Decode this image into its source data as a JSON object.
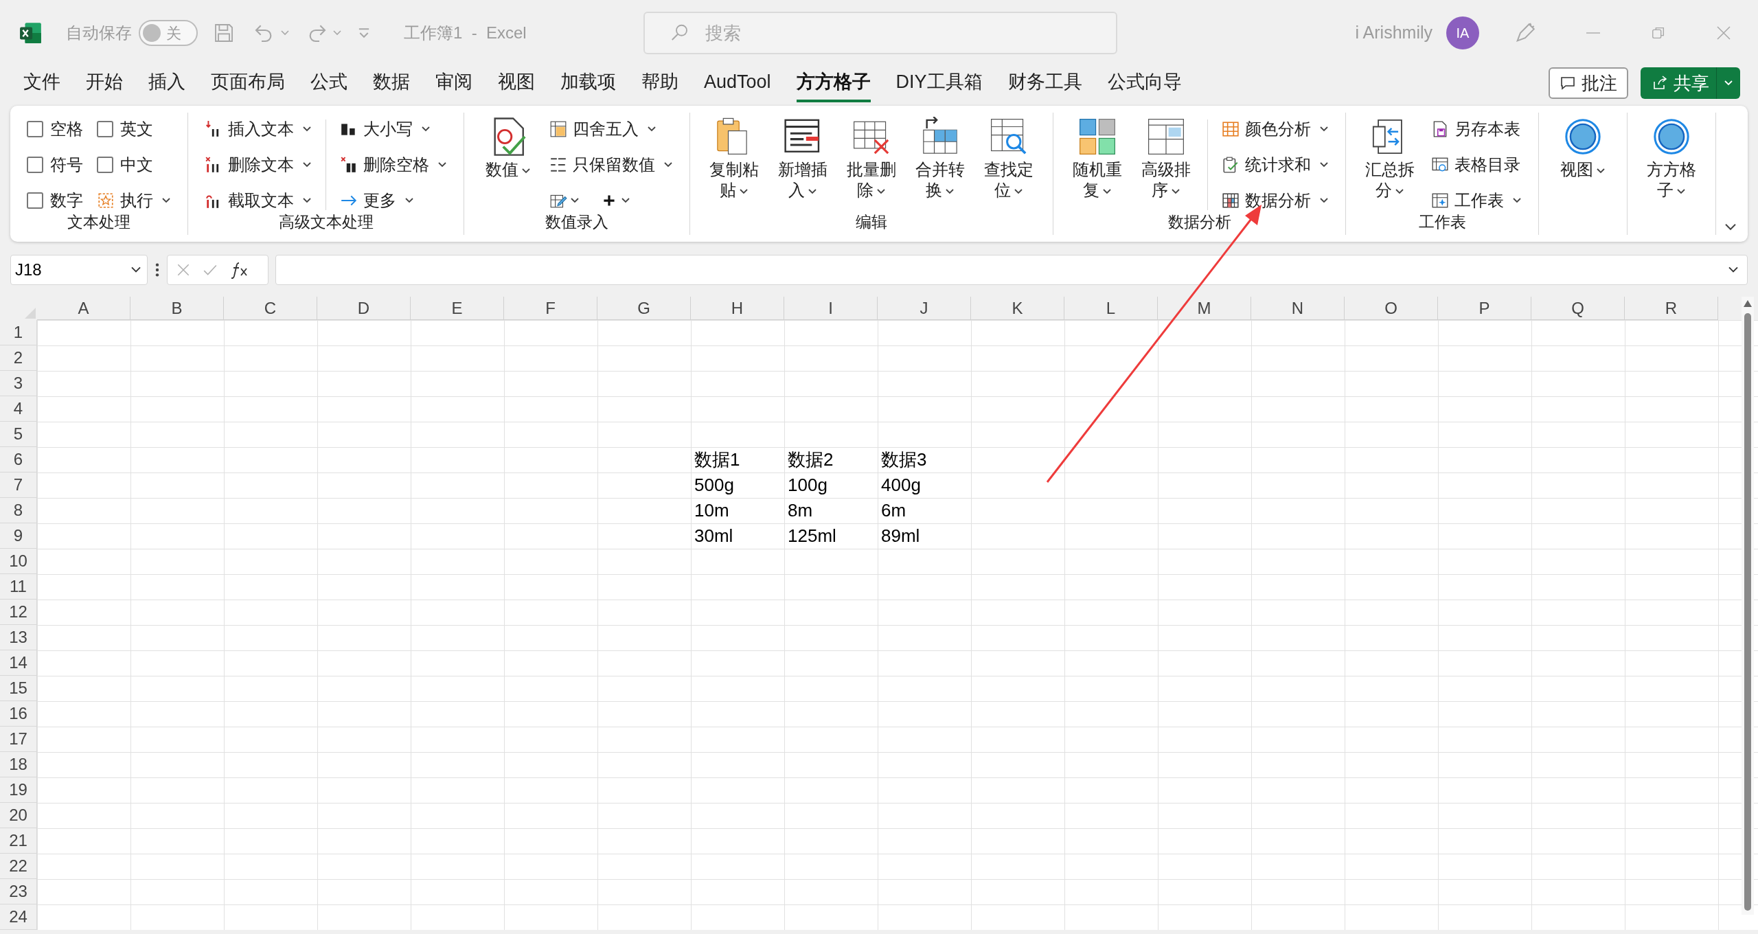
{
  "title_bar": {
    "autosave_label": "自动保存",
    "autosave_toggle": {
      "on": false,
      "label": "关"
    },
    "document_title": "工作簿1  -  Excel",
    "search": {
      "placeholder": "搜索"
    },
    "user_name": "i Arishmily",
    "avatar_initials": "IA"
  },
  "menu_tabs": [
    {
      "label": "文件",
      "selected": false
    },
    {
      "label": "开始",
      "selected": false
    },
    {
      "label": "插入",
      "selected": false
    },
    {
      "label": "页面布局",
      "selected": false
    },
    {
      "label": "公式",
      "selected": false
    },
    {
      "label": "数据",
      "selected": false
    },
    {
      "label": "审阅",
      "selected": false
    },
    {
      "label": "视图",
      "selected": false
    },
    {
      "label": "加载项",
      "selected": false
    },
    {
      "label": "帮助",
      "selected": false
    },
    {
      "label": "AudTool",
      "selected": false
    },
    {
      "label": "方方格子",
      "selected": true
    },
    {
      "label": "DIY工具箱",
      "selected": false
    },
    {
      "label": "财务工具",
      "selected": false
    },
    {
      "label": "公式向导",
      "selected": false
    }
  ],
  "comment_button": "批注",
  "share_button": "共享",
  "ribbon_groups": [
    {
      "name": "文本处理",
      "blocks": [
        {
          "kind": "stack",
          "items": [
            {
              "kind": "checkbox",
              "label": "空格",
              "checked": false
            },
            {
              "kind": "checkbox",
              "label": "符号",
              "checked": false
            },
            {
              "kind": "checkbox",
              "label": "数字",
              "checked": false
            }
          ]
        },
        {
          "kind": "stack",
          "items": [
            {
              "kind": "checkbox",
              "label": "英文",
              "checked": false
            },
            {
              "kind": "checkbox",
              "label": "中文",
              "checked": false
            },
            {
              "kind": "button",
              "label": "执行",
              "dropdown": true
            }
          ]
        }
      ]
    },
    {
      "name": "高级文本处理",
      "blocks": [
        {
          "kind": "stack",
          "items": [
            {
              "kind": "button",
              "label": "插入文本",
              "dropdown": true
            },
            {
              "kind": "button",
              "label": "删除文本",
              "dropdown": true
            },
            {
              "kind": "button",
              "label": "截取文本",
              "dropdown": true
            }
          ]
        },
        {
          "kind": "divider"
        },
        {
          "kind": "stack",
          "items": [
            {
              "kind": "button",
              "label": "大小写",
              "dropdown": true
            },
            {
              "kind": "button",
              "label": "删除空格",
              "dropdown": true
            },
            {
              "kind": "button",
              "label": "更多",
              "dropdown": true
            }
          ]
        }
      ]
    },
    {
      "name": "数值录入",
      "blocks": [
        {
          "kind": "large",
          "label": "数值",
          "dropdown": true
        },
        {
          "kind": "stack",
          "items": [
            {
              "kind": "button",
              "label": "四舍五入",
              "dropdown": true
            },
            {
              "kind": "button",
              "label": "只保留数值",
              "dropdown": true
            },
            {
              "kind": "icon_pair",
              "dropdown": true
            }
          ]
        }
      ]
    },
    {
      "name": "编辑",
      "blocks": [
        {
          "kind": "large",
          "label": "复制粘贴",
          "dropdown": true
        },
        {
          "kind": "large",
          "label": "新增插入",
          "dropdown": true
        },
        {
          "kind": "large",
          "label": "批量删除",
          "dropdown": true
        },
        {
          "kind": "large",
          "label": "合并转换",
          "dropdown": true
        },
        {
          "kind": "large",
          "label": "查找定位",
          "dropdown": true
        }
      ]
    },
    {
      "name": "数据分析",
      "blocks": [
        {
          "kind": "large",
          "label": "随机重复",
          "dropdown": true
        },
        {
          "kind": "large",
          "label": "高级排序",
          "dropdown": true
        },
        {
          "kind": "divider"
        },
        {
          "kind": "stack",
          "items": [
            {
              "kind": "button",
              "label": "颜色分析",
              "dropdown": true
            },
            {
              "kind": "button",
              "label": "统计求和",
              "dropdown": true
            },
            {
              "kind": "button",
              "label": "数据分析",
              "dropdown": true
            }
          ]
        }
      ]
    },
    {
      "name": "工作表",
      "blocks": [
        {
          "kind": "large",
          "label": "汇总拆分",
          "dropdown": true
        },
        {
          "kind": "stack",
          "items": [
            {
              "kind": "button",
              "label": "另存本表",
              "dropdown": false
            },
            {
              "kind": "button",
              "label": "表格目录",
              "dropdown": false
            },
            {
              "kind": "button",
              "label": "工作表",
              "dropdown": true
            }
          ]
        }
      ]
    },
    {
      "blocks": [
        {
          "kind": "large",
          "label": "视图",
          "dropdown": true
        }
      ]
    },
    {
      "blocks": [
        {
          "kind": "large",
          "label": "方方格子",
          "dropdown": true
        }
      ]
    }
  ],
  "formula_bar": {
    "name_box": "J18"
  },
  "sheet": {
    "columns": [
      "A",
      "B",
      "C",
      "D",
      "E",
      "F",
      "G",
      "H",
      "I",
      "J",
      "K",
      "L",
      "M",
      "N",
      "O",
      "P",
      "Q",
      "R"
    ],
    "rows": [
      {
        "header": "1"
      },
      {
        "header": "2"
      },
      {
        "header": "3"
      },
      {
        "header": "4"
      },
      {
        "header": "5"
      },
      {
        "header": "6",
        "cells": [
          null,
          null,
          null,
          null,
          null,
          null,
          null,
          "数据1",
          "数据2",
          "数据3"
        ]
      },
      {
        "header": "7",
        "cells": [
          null,
          null,
          null,
          null,
          null,
          null,
          null,
          "500g",
          "100g",
          "400g"
        ]
      },
      {
        "header": "8",
        "cells": [
          null,
          null,
          null,
          null,
          null,
          null,
          null,
          "10m",
          "8m",
          "6m"
        ]
      },
      {
        "header": "9",
        "cells": [
          null,
          null,
          null,
          null,
          null,
          null,
          null,
          "30ml",
          "125ml",
          "89ml"
        ]
      },
      {
        "header": "10"
      },
      {
        "header": "11"
      },
      {
        "header": "12"
      },
      {
        "header": "13"
      },
      {
        "header": "14"
      },
      {
        "header": "15"
      },
      {
        "header": "16"
      },
      {
        "header": "17"
      },
      {
        "header": "18"
      },
      {
        "header": "19"
      },
      {
        "header": "20"
      },
      {
        "header": "21"
      },
      {
        "header": "22"
      },
      {
        "header": "23"
      },
      {
        "header": "24"
      }
    ]
  }
}
